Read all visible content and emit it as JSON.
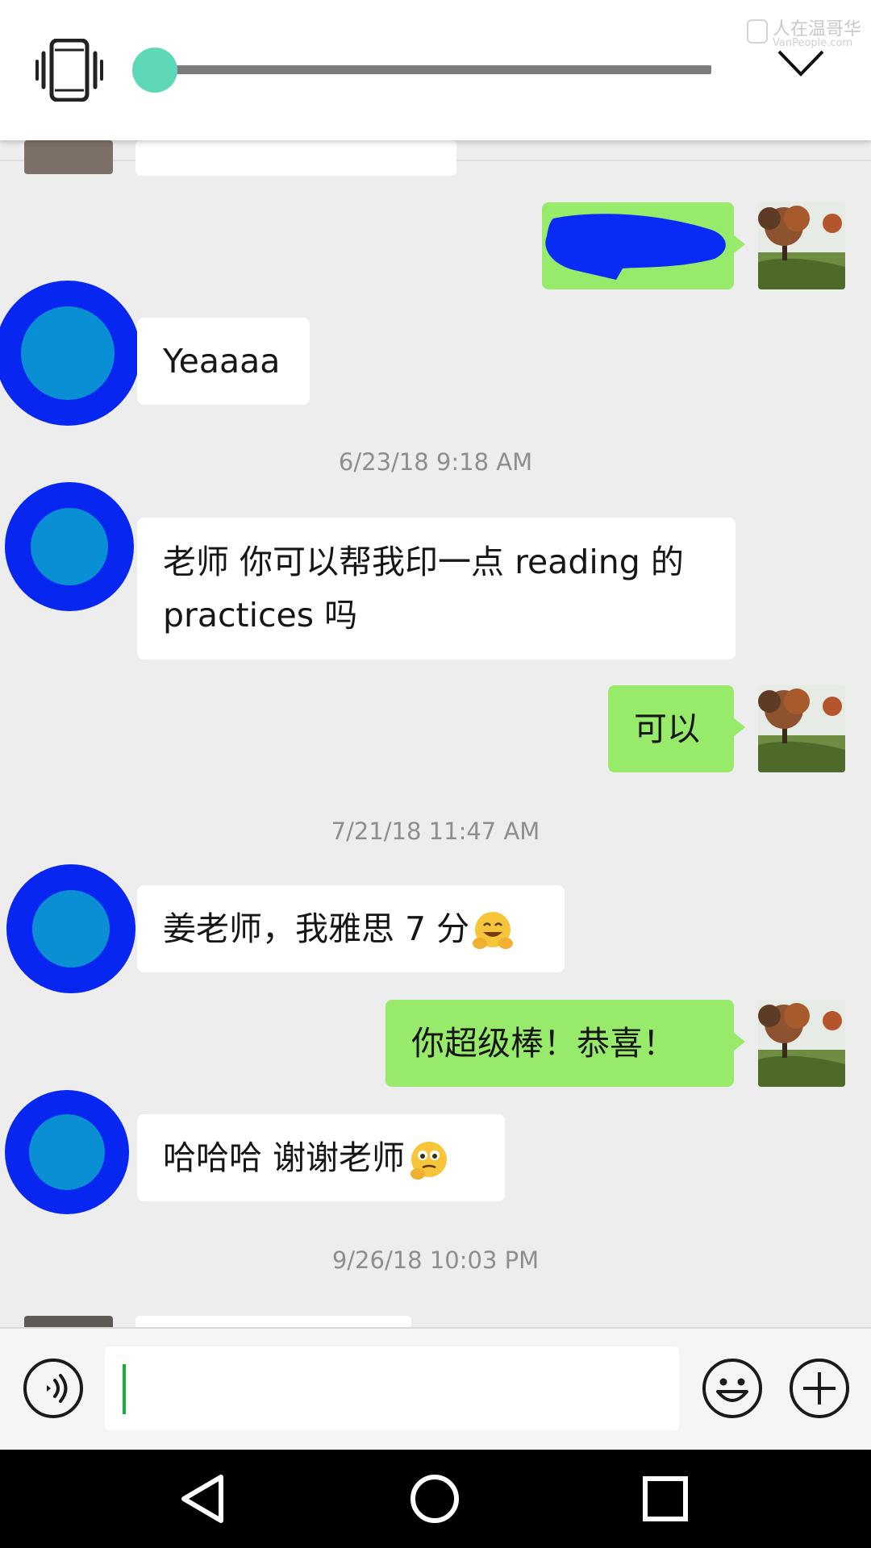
{
  "top_bar": {
    "vibrate_icon": "phone-vibrate-icon",
    "playback_progress": 0.0,
    "collapse_icon": "chevron-down-icon",
    "watermark": {
      "line1": "人在温哥华",
      "line2": "VanPeople.com"
    }
  },
  "messages": [
    {
      "side": "out",
      "type": "redacted",
      "text": ""
    },
    {
      "side": "in",
      "type": "text",
      "text": "Yeaaaa"
    },
    {
      "type": "timestamp",
      "text": "6/23/18 9:18 AM"
    },
    {
      "side": "in",
      "type": "text",
      "lines": [
        "老师 你可以帮我印一点 reading 的",
        "practices 吗"
      ]
    },
    {
      "side": "out",
      "type": "text",
      "text": "可以"
    },
    {
      "type": "timestamp",
      "text": "7/21/18 11:47 AM"
    },
    {
      "side": "in",
      "type": "text",
      "text": "姜老师，我雅思 7 分",
      "emoji": "hug-emoji"
    },
    {
      "side": "out",
      "type": "text",
      "text": "你超级棒！恭喜！"
    },
    {
      "side": "in",
      "type": "text",
      "text": "哈哈哈 谢谢老师",
      "emoji": "thinking-emoji"
    },
    {
      "type": "timestamp",
      "text": "9/26/18 10:03 PM"
    }
  ],
  "input_bar": {
    "voice_icon": "voice-mode-icon",
    "text_value": "",
    "emoji_icon": "smiley-icon",
    "plus_icon": "plus-icon"
  },
  "nav_bar": {
    "back_icon": "back-triangle-icon",
    "home_icon": "home-circle-icon",
    "recents_icon": "recents-square-icon"
  },
  "colors": {
    "outgoing_bubble": "#97ea6a",
    "incoming_bubble": "#ffffff",
    "chat_background": "#ededed",
    "slider_knob": "#5fd8b8",
    "avatar_outer": "#0726ef",
    "avatar_inner": "#0a8fd4",
    "redaction": "#0a2bf5"
  }
}
